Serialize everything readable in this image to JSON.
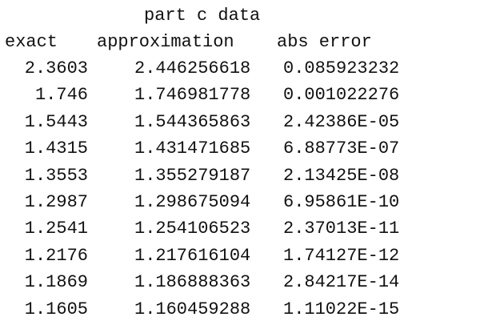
{
  "title": "part c data",
  "headers": {
    "exact": "exact",
    "approximation": "approximation",
    "abs_error": "abs error"
  },
  "rows": [
    {
      "exact": "2.3603",
      "approximation": "2.446256618",
      "abs_error": "0.085923232"
    },
    {
      "exact": "1.746",
      "approximation": "1.746981778",
      "abs_error": "0.001022276"
    },
    {
      "exact": "1.5443",
      "approximation": "1.544365863",
      "abs_error": "2.42386E-05"
    },
    {
      "exact": "1.4315",
      "approximation": "1.431471685",
      "abs_error": "6.88773E-07"
    },
    {
      "exact": "1.3553",
      "approximation": "1.355279187",
      "abs_error": "2.13425E-08"
    },
    {
      "exact": "1.2987",
      "approximation": "1.298675094",
      "abs_error": "6.95861E-10"
    },
    {
      "exact": "1.2541",
      "approximation": "1.254106523",
      "abs_error": "2.37013E-11"
    },
    {
      "exact": "1.2176",
      "approximation": "1.217616104",
      "abs_error": "1.74127E-12"
    },
    {
      "exact": "1.1869",
      "approximation": "1.186888363",
      "abs_error": "2.84217E-14"
    },
    {
      "exact": "1.1605",
      "approximation": "1.160459288",
      "abs_error": "1.11022E-15"
    }
  ]
}
